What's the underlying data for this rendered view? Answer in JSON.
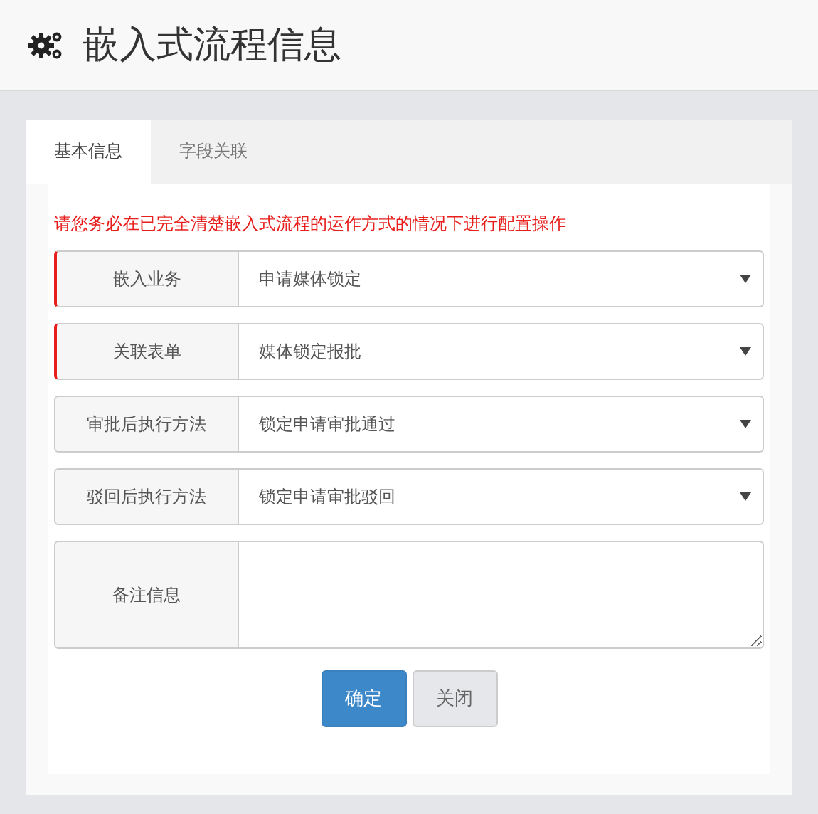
{
  "page": {
    "title": "嵌入式流程信息"
  },
  "tabs": [
    {
      "label": "基本信息",
      "selected": true
    },
    {
      "label": "字段关联",
      "selected": false
    }
  ],
  "warning": "请您务必在已完全清楚嵌入式流程的运作方式的情况下进行配置操作",
  "fields": [
    {
      "kind": "select",
      "label": "嵌入业务",
      "required": true,
      "value": "申请媒体锁定"
    },
    {
      "kind": "select",
      "label": "关联表单",
      "required": true,
      "value": "媒体锁定报批"
    },
    {
      "kind": "select",
      "label": "审批后执行方法",
      "required": false,
      "value": "锁定申请审批通过"
    },
    {
      "kind": "select",
      "label": "驳回后执行方法",
      "required": false,
      "value": "锁定申请审批驳回"
    },
    {
      "kind": "textarea",
      "label": "备注信息",
      "required": false
    }
  ],
  "buttons": [
    {
      "label": "确定",
      "kind": "primary"
    },
    {
      "label": "关闭",
      "kind": "default"
    }
  ]
}
